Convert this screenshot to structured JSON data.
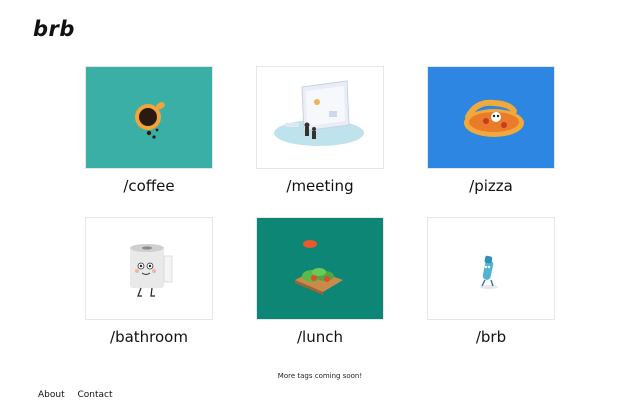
{
  "header": {
    "logo": "brb"
  },
  "tags": [
    {
      "label": "/coffee",
      "icon": "coffee-cup-icon",
      "bg": "#3aafa5"
    },
    {
      "label": "/meeting",
      "icon": "meeting-screen-icon",
      "bg": "#ffffff"
    },
    {
      "label": "/pizza",
      "icon": "pizza-icon",
      "bg": "#2c86e2"
    },
    {
      "label": "/bathroom",
      "icon": "toilet-paper-icon",
      "bg": "#ffffff"
    },
    {
      "label": "/lunch",
      "icon": "sandwich-icon",
      "bg": "#0e8675"
    },
    {
      "label": "/brb",
      "icon": "running-figure-icon",
      "bg": "#ffffff"
    }
  ],
  "notice": "More tags coming soon!",
  "footer": {
    "about": "About",
    "contact": "Contact"
  }
}
